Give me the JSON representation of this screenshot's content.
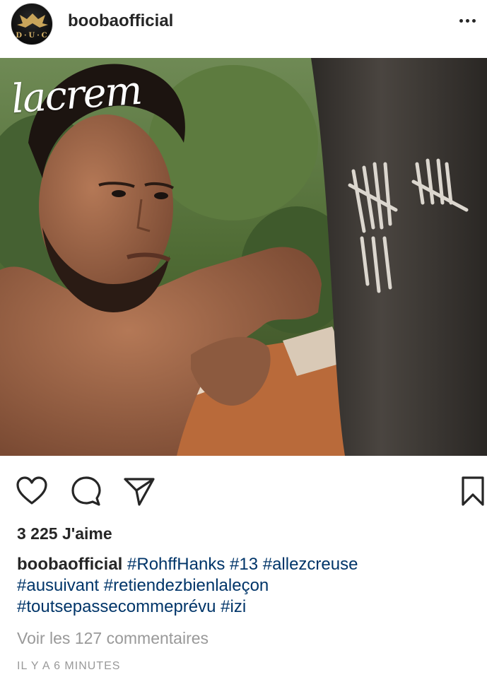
{
  "header": {
    "username": "boobaofficial",
    "avatar_text": "D·U·C",
    "more_icon": "more-horizontal-icon"
  },
  "post": {
    "watermark": "lacrem",
    "image_description_colors": {
      "foliage": "#4f6b34",
      "trunk": "#3f3a35",
      "skin": "#a26a4c"
    }
  },
  "actions": {
    "like_icon": "heart-icon",
    "comment_icon": "comment-icon",
    "share_icon": "send-icon",
    "save_icon": "bookmark-icon"
  },
  "likes_text": "3 225 J'aime",
  "caption": {
    "username": "boobaofficial",
    "hashtags": [
      "#RohffHanks",
      "#13",
      "#allezcreuse",
      "#ausuivant",
      "#retiendezbienlaleçon",
      "#toutsepassecommeprévu",
      "#izi"
    ]
  },
  "comments_link": "Voir les 127 commentaires",
  "timestamp": "IL Y A 6 MINUTES",
  "colors": {
    "text": "#262626",
    "hashtag": "#003569",
    "muted": "#999999"
  }
}
